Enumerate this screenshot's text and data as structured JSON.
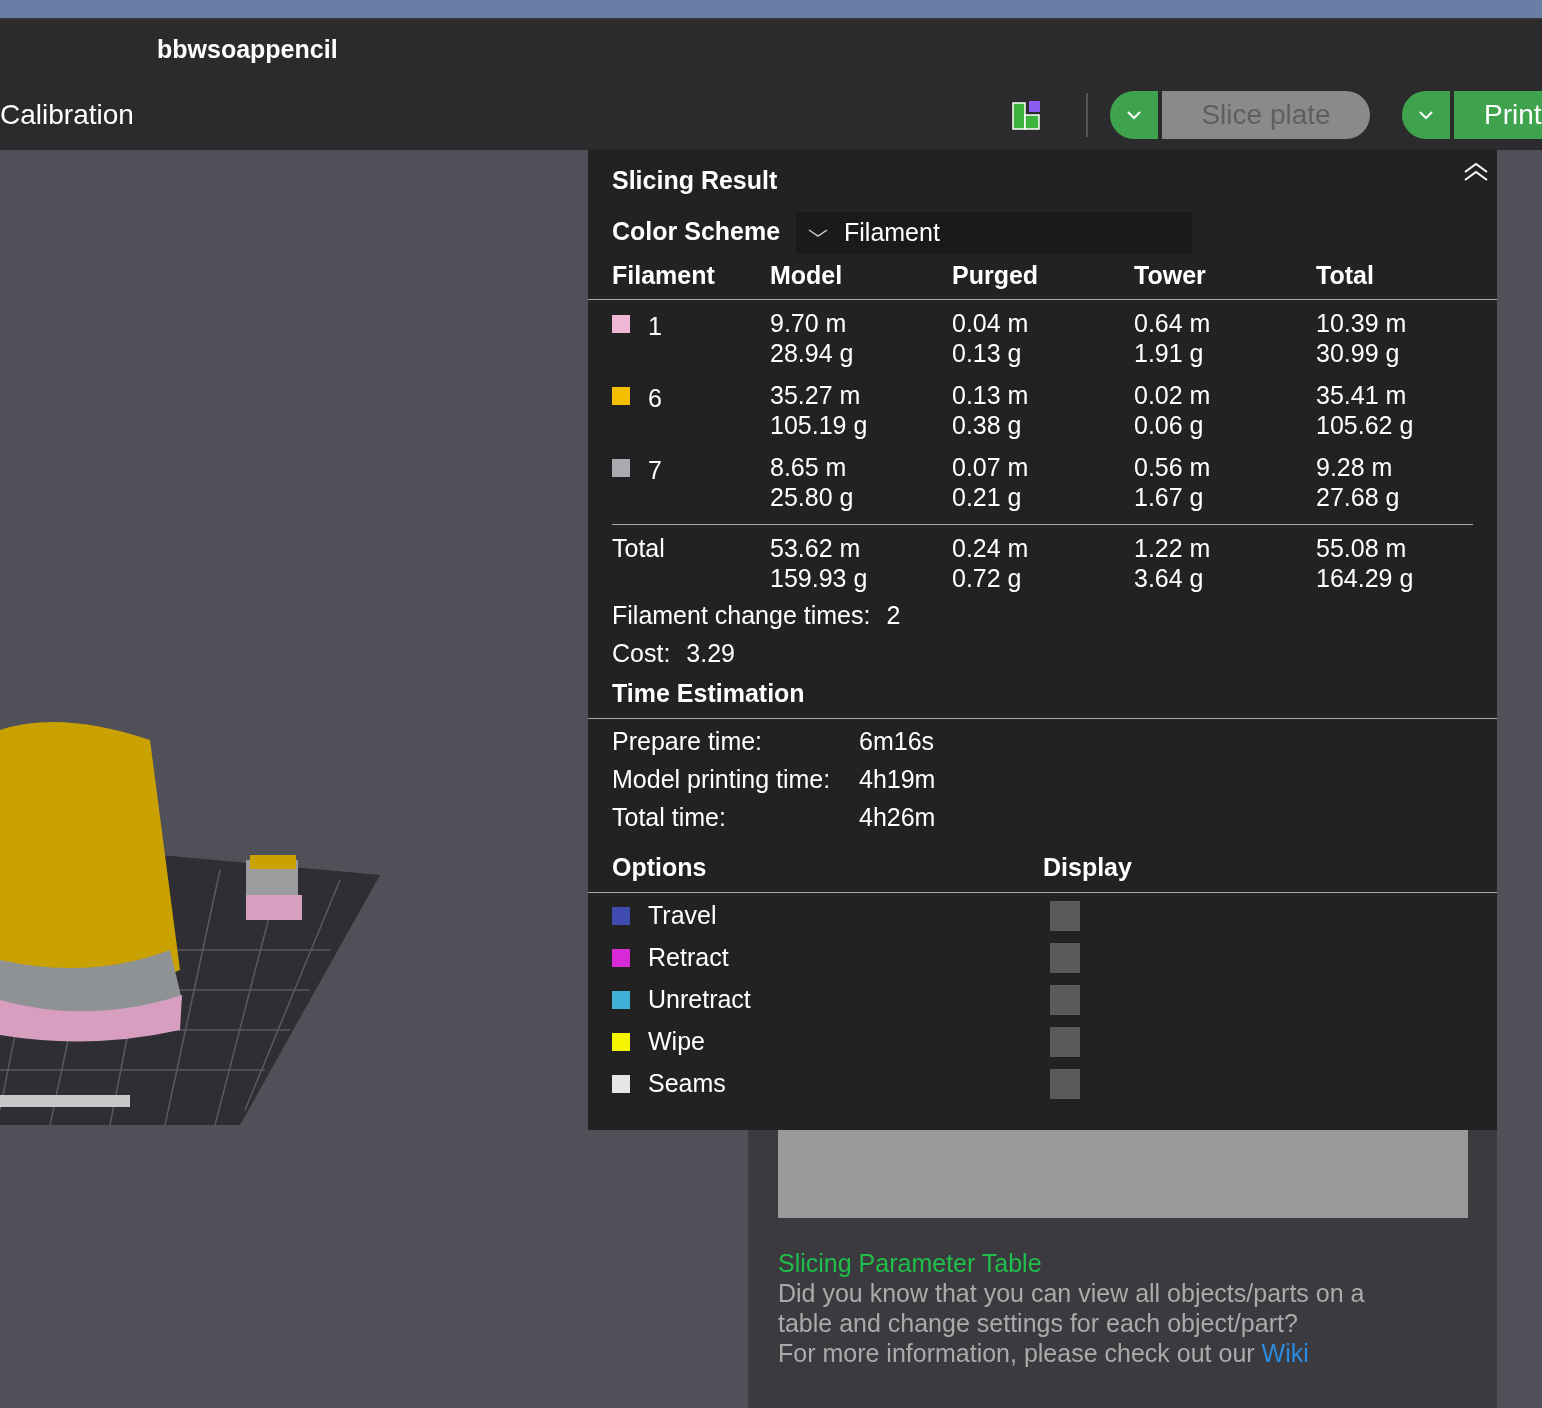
{
  "window": {
    "title": "bbwsoappencil"
  },
  "toolbar": {
    "tab": "Calibration",
    "slice_button": {
      "label": "Slice plate",
      "disabled": true
    },
    "print_button": {
      "label": "Print",
      "disabled": false
    }
  },
  "slicing_result": {
    "title": "Slicing Result",
    "color_scheme": {
      "label": "Color Scheme",
      "value": "Filament"
    },
    "columns": [
      "Filament",
      "Model",
      "Purged",
      "Tower",
      "Total"
    ],
    "filaments": [
      {
        "id": "1",
        "color": "#f0b6d6",
        "model": [
          "9.70 m",
          "28.94 g"
        ],
        "purged": [
          "0.04 m",
          "0.13 g"
        ],
        "tower": [
          "0.64 m",
          "1.91 g"
        ],
        "total": [
          "10.39 m",
          "30.99 g"
        ]
      },
      {
        "id": "6",
        "color": "#f5c000",
        "model": [
          "35.27 m",
          "105.19 g"
        ],
        "purged": [
          "0.13 m",
          "0.38 g"
        ],
        "tower": [
          "0.02 m",
          "0.06 g"
        ],
        "total": [
          "35.41 m",
          "105.62 g"
        ]
      },
      {
        "id": "7",
        "color": "#a9abb0",
        "model": [
          "8.65 m",
          "25.80 g"
        ],
        "purged": [
          "0.07 m",
          "0.21 g"
        ],
        "tower": [
          "0.56 m",
          "1.67 g"
        ],
        "total": [
          "9.28 m",
          "27.68 g"
        ]
      }
    ],
    "total": {
      "label": "Total",
      "model": [
        "53.62 m",
        "159.93 g"
      ],
      "purged": [
        "0.24 m",
        "0.72 g"
      ],
      "tower": [
        "1.22 m",
        "3.64 g"
      ],
      "total": [
        "55.08 m",
        "164.29 g"
      ]
    },
    "change_times": {
      "label": "Filament change times:",
      "value": "2"
    },
    "cost": {
      "label": "Cost:",
      "value": "3.29"
    },
    "time_estimation": {
      "title": "Time Estimation",
      "rows": [
        {
          "label": "Prepare time:",
          "value": "6m16s"
        },
        {
          "label": "Model printing time:",
          "value": "4h19m"
        },
        {
          "label": "Total time:",
          "value": "4h26m"
        }
      ]
    },
    "options": {
      "title": "Options",
      "display_title": "Display",
      "items": [
        {
          "label": "Travel",
          "color": "#3f4bb0",
          "checked": false
        },
        {
          "label": "Retract",
          "color": "#d72ad6",
          "checked": false
        },
        {
          "label": "Unretract",
          "color": "#3fb0d8",
          "checked": false
        },
        {
          "label": "Wipe",
          "color": "#f5f500",
          "checked": false
        },
        {
          "label": "Seams",
          "color": "#e6e6e6",
          "checked": false
        }
      ]
    }
  },
  "tip": {
    "title": "Slicing Parameter Table",
    "body": "Did you know that you can view all objects/parts on a table and change settings for each object/part?",
    "more": "For more information, please check out our",
    "link": "Wiki"
  }
}
